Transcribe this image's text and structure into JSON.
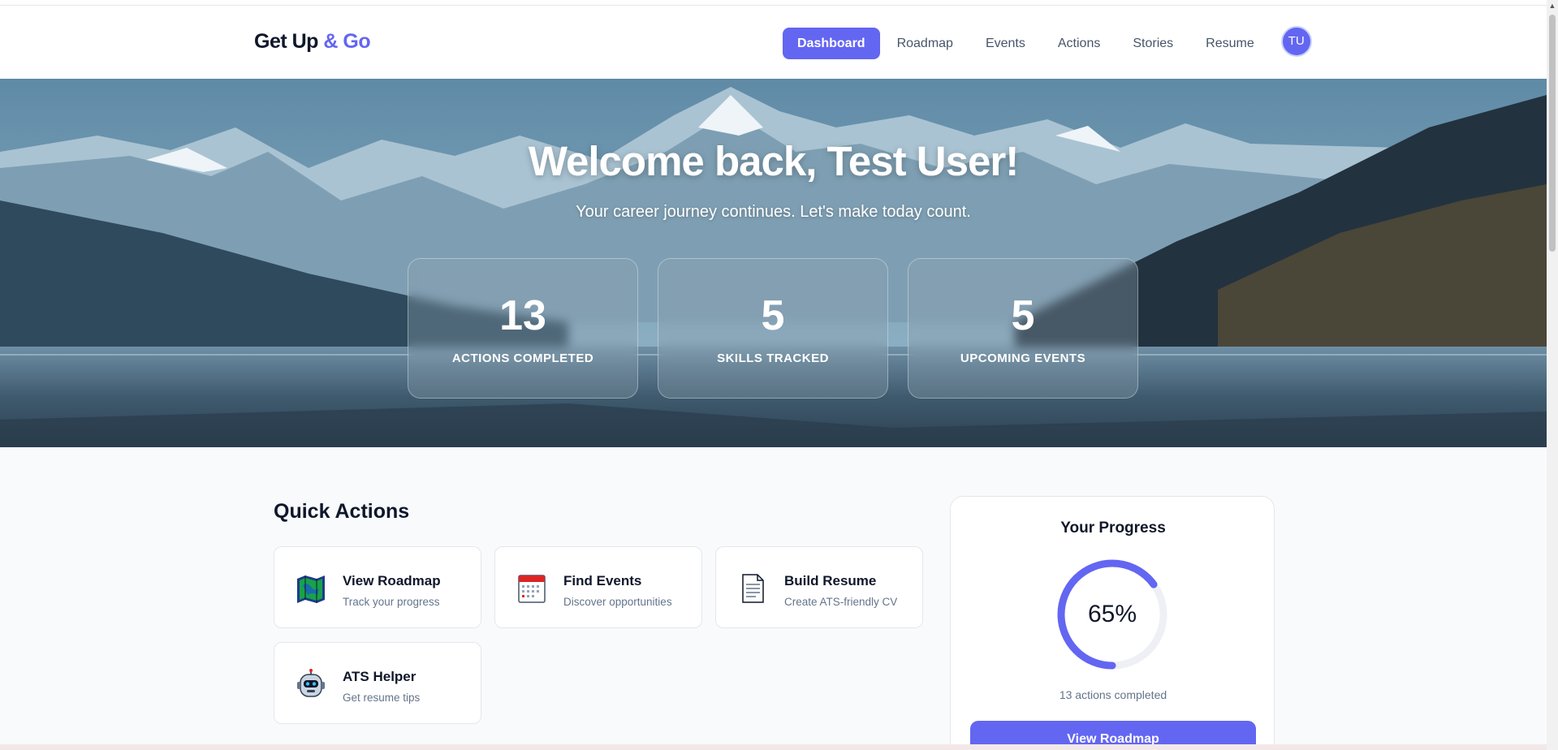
{
  "brand": {
    "name": "Get Up",
    "accent": "& Go"
  },
  "nav": {
    "items": [
      "Dashboard",
      "Roadmap",
      "Events",
      "Actions",
      "Stories",
      "Resume"
    ],
    "active": "Dashboard",
    "avatar_initials": "TU"
  },
  "hero": {
    "title": "Welcome back, Test User!",
    "subtitle": "Your career journey continues. Let's make today count.",
    "stats": [
      {
        "value": "13",
        "label": "ACTIONS COMPLETED"
      },
      {
        "value": "5",
        "label": "SKILLS TRACKED"
      },
      {
        "value": "5",
        "label": "UPCOMING EVENTS"
      }
    ]
  },
  "quick_actions": {
    "title": "Quick Actions",
    "cards": [
      {
        "title": "View Roadmap",
        "subtitle": "Track your progress",
        "icon": "map-icon"
      },
      {
        "title": "Find Events",
        "subtitle": "Discover opportunities",
        "icon": "calendar-icon"
      },
      {
        "title": "Build Resume",
        "subtitle": "Create ATS-friendly CV",
        "icon": "document-icon"
      },
      {
        "title": "ATS Helper",
        "subtitle": "Get resume tips",
        "icon": "robot-icon"
      }
    ]
  },
  "progress": {
    "title": "Your Progress",
    "percent_label": "65%",
    "percent": 0.65,
    "subtitle": "13 actions completed",
    "button_label": "View Roadmap"
  },
  "colors": {
    "accent": "#6366f1",
    "text": "#0f172a",
    "muted": "#64748b",
    "background": "#f8fafc"
  }
}
